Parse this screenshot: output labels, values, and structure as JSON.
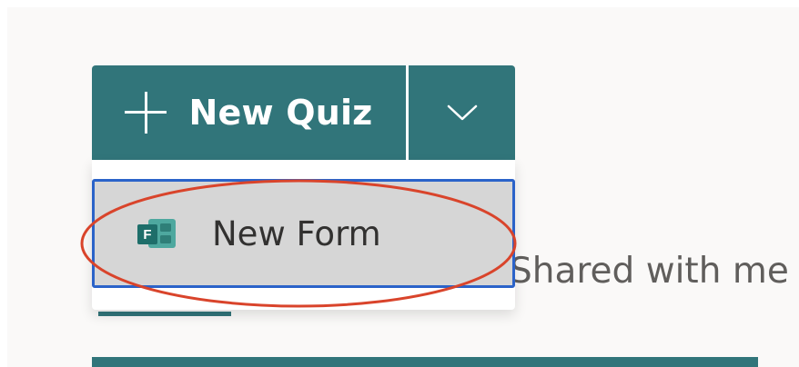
{
  "toolbar": {
    "new_quiz_label": "New Quiz",
    "plus_icon": "plus-icon",
    "dropdown_icon": "chevron-down-icon"
  },
  "menu": {
    "items": [
      {
        "label": "New Form",
        "icon": "forms-app-icon",
        "icon_letter": "F"
      }
    ]
  },
  "tabs": {
    "shared_with_me": "Shared with me"
  },
  "colors": {
    "accent": "#31757a",
    "menu_selected_bg": "#d6d6d6",
    "focus_border": "#2b63c9",
    "annotation": "#d9442b"
  }
}
